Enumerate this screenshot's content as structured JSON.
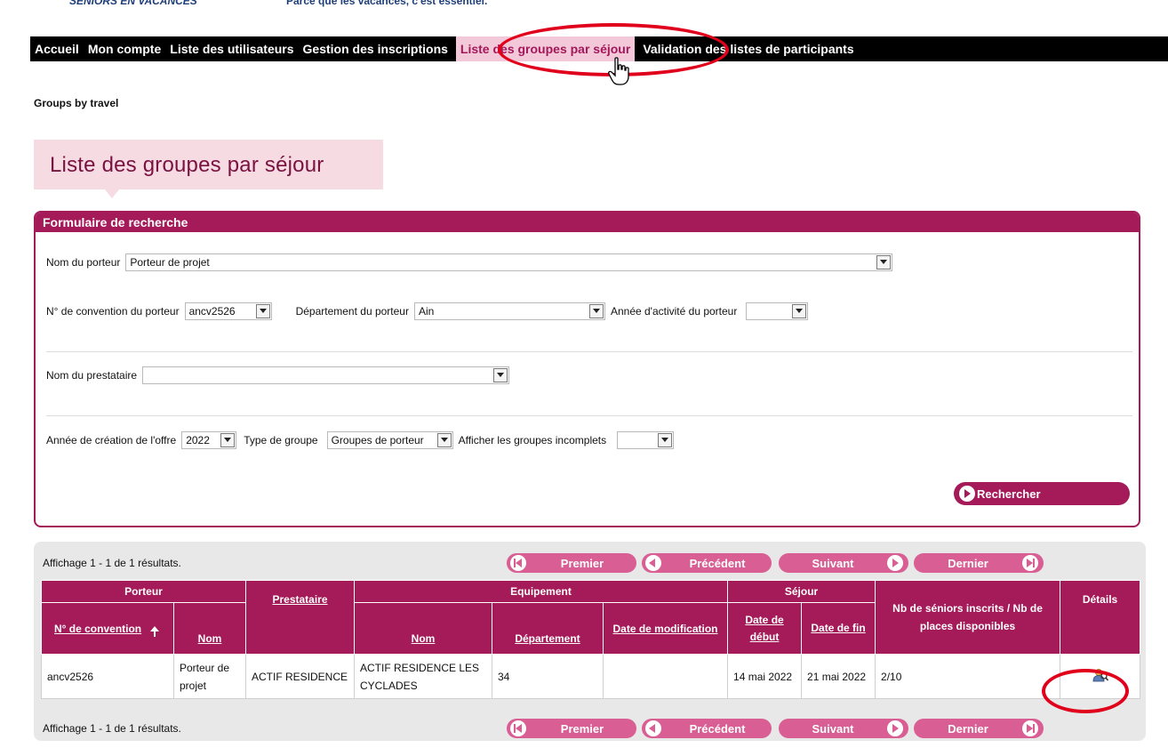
{
  "banner": {
    "brand": "SENIORS EN VACANCES",
    "tagline": "Parce que les vacances, c'est essentiel."
  },
  "nav": {
    "items": [
      {
        "label": "Accueil"
      },
      {
        "label": "Mon compte"
      },
      {
        "label": "Liste des utilisateurs"
      },
      {
        "label": "Gestion des inscriptions"
      },
      {
        "label": "Liste des groupes par séjour",
        "active": true
      },
      {
        "label": "Validation des listes de participants"
      }
    ]
  },
  "breadcrumb": "Groups by travel",
  "page_title": "Liste des groupes par séjour",
  "search_form": {
    "title": "Formulaire de recherche",
    "porteur_label": "Nom du porteur",
    "porteur_value": "Porteur de projet",
    "convention_label": "N° de convention du porteur",
    "convention_value": "ancv2526",
    "departement_label": "Département du porteur",
    "departement_value": "Ain",
    "annee_activite_label": "Année d'activité du porteur",
    "annee_activite_value": "",
    "prestataire_label": "Nom du prestataire",
    "prestataire_value": "",
    "annee_creation_label": "Année de création de l'offre",
    "annee_creation_value": "2022",
    "type_groupe_label": "Type de groupe",
    "type_groupe_value": "Groupes de porteur",
    "incomplets_label": "Afficher les groupes incomplets",
    "incomplets_value": "",
    "search_button": "Rechercher"
  },
  "results": {
    "count_text": "Affichage 1 - 1 de 1 résultats.",
    "pagination": {
      "first": "Premier",
      "prev": "Précédent",
      "next": "Suivant",
      "last": "Dernier"
    },
    "group_headers": {
      "porteur": "Porteur",
      "equipement": "Equipement",
      "sejour": "Séjour",
      "nb": "Nb de séniors inscrits / Nb de places disponibles",
      "details": "Détails"
    },
    "columns": {
      "convention": "N° de convention",
      "nom_porteur": "Nom",
      "prestataire": "Prestataire",
      "nom_equipement": "Nom",
      "departement": "Département",
      "date_modif": "Date de modification",
      "date_debut": "Date de début",
      "date_fin": "Date de fin"
    },
    "rows": [
      {
        "convention": "ancv2526",
        "nom_porteur": "Porteur de projet",
        "prestataire": "ACTIF RESIDENCE",
        "nom_equipement": "ACTIF RESIDENCE LES CYCLADES",
        "departement": "34",
        "date_modif": "",
        "date_debut": "14 mai 2022",
        "date_fin": "21 mai 2022",
        "nb": "2/10",
        "details_icon": "details-icon"
      }
    ]
  }
}
